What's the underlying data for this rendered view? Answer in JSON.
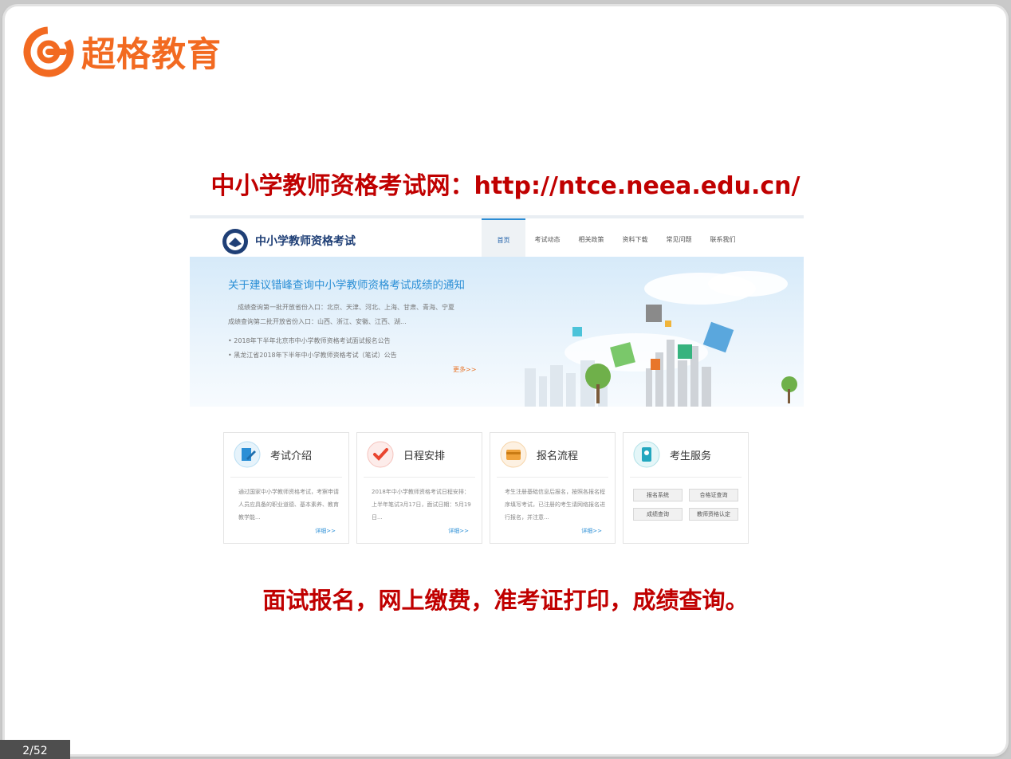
{
  "logo": {
    "text": "超格教育",
    "icon": "cg-logo-icon",
    "color": "#f26a21"
  },
  "headline_top": "中小学教师资格考试网：http://ntce.neea.edu.cn/",
  "headline_bottom": "面试报名，网上缴费，准考证打印，成绩查询。",
  "website": {
    "site_title": "中小学教师资格考试",
    "nav": [
      "首页",
      "考试动态",
      "相关政策",
      "资料下载",
      "常见问题",
      "联系我们"
    ],
    "banner": {
      "title": "关于建议错峰查询中小学教师资格考试成绩的通知",
      "lines": [
        "成绩查询第一批开放省份入口：北京、天津、河北、上海、甘肃、青海、宁夏",
        "成绩查询第二批开放省份入口：山西、浙江、安徽、江西、湖...",
        "• 2018年下半年北京市中小学教师资格考试面试报名公告",
        "• 黑龙江省2018年下半年中小学教师资格考试（笔试）公告"
      ],
      "more": "更多>>"
    },
    "cards": [
      {
        "title": "考试介绍",
        "desc": "通过国家中小学教师资格考试，考察申请人员应具备的职业道德、基本素养、教育教学能...",
        "more": "详细>>",
        "icon": "edit-icon"
      },
      {
        "title": "日程安排",
        "desc": "2018年中小学教师资格考试日程安排：上半年笔试3月17日，面试日期：5月19日...",
        "more": "详细>>",
        "icon": "check-icon"
      },
      {
        "title": "报名流程",
        "desc": "考生注册基础信息后报名，按照各报名程序填写考试，已注册的考生请网络报名进行报名，并注意...",
        "more": "详细>>",
        "icon": "card-icon"
      },
      {
        "title": "考生服务",
        "buttons": [
          "报名系统",
          "合格证查询",
          "成绩查询",
          "教师资格认定"
        ],
        "icon": "user-badge-icon"
      }
    ]
  },
  "page_counter": "2/52"
}
